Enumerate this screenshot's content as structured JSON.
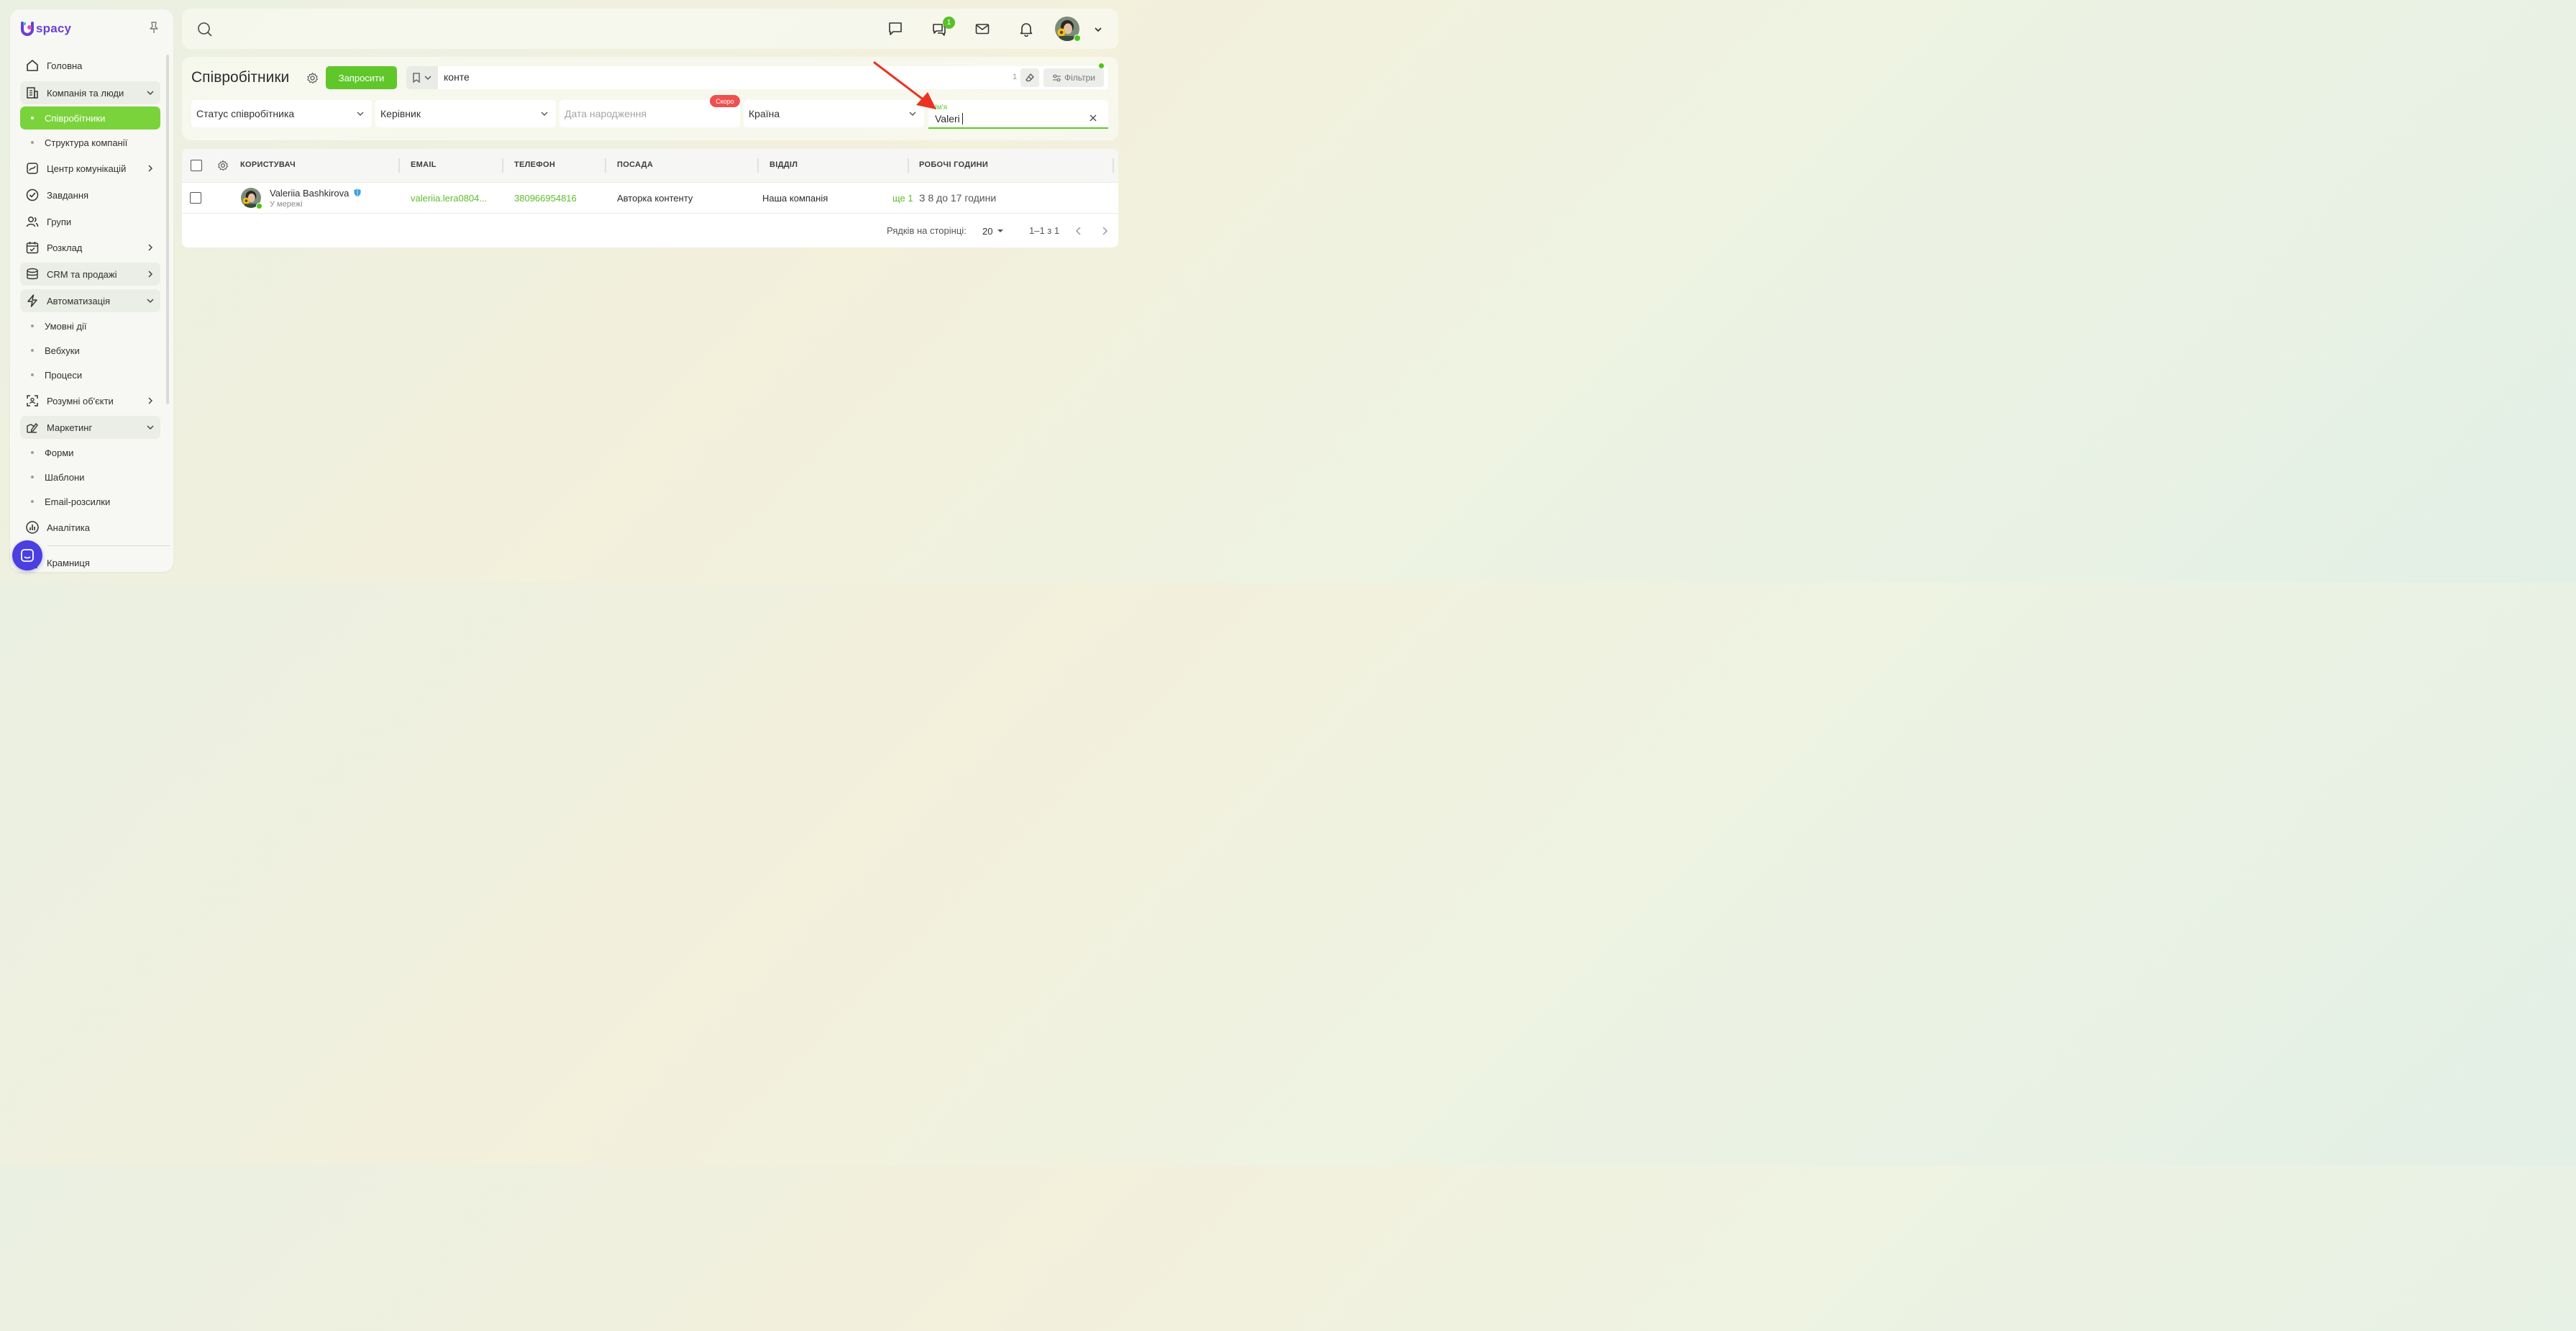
{
  "logo": {
    "text": "spacy",
    "brand_color": "#6a3fd6"
  },
  "sidebar": {
    "items": [
      {
        "label": "Головна",
        "icon": "home-icon"
      },
      {
        "label": "Компанія та люди",
        "icon": "company-icon"
      },
      {
        "label": "Співробітники",
        "icon": ""
      },
      {
        "label": "Структура компанії",
        "icon": ""
      },
      {
        "label": "Центр комунікацій",
        "icon": "communications-icon"
      },
      {
        "label": "Завдання",
        "icon": "tasks-icon"
      },
      {
        "label": "Групи",
        "icon": "groups-icon"
      },
      {
        "label": "Розклад",
        "icon": "calendar-icon"
      },
      {
        "label": "CRM та продажі",
        "icon": "crm-icon"
      },
      {
        "label": "Автоматизація",
        "icon": "automation-icon"
      },
      {
        "label": "Умовні дії",
        "icon": ""
      },
      {
        "label": "Вебхуки",
        "icon": ""
      },
      {
        "label": "Процеси",
        "icon": ""
      },
      {
        "label": "Розумні об'єкти",
        "icon": "smart-objects-icon"
      },
      {
        "label": "Маркетинг",
        "icon": "marketing-icon"
      },
      {
        "label": "Форми",
        "icon": ""
      },
      {
        "label": "Шаблони",
        "icon": ""
      },
      {
        "label": "Email-розсилки",
        "icon": ""
      },
      {
        "label": "Аналітика",
        "icon": "analytics-icon"
      },
      {
        "label": "Крамниця",
        "icon": "store-icon"
      }
    ],
    "active_color": "#7ad33a"
  },
  "topbar": {
    "chat_badge": "1"
  },
  "header": {
    "title": "Співробітники",
    "invite_label": "Запросити",
    "search_value": "конте",
    "search_count": "1",
    "filters_label": "Фільтри"
  },
  "filters": {
    "status": "Статус співробітника",
    "manager": "Керівник",
    "birthdate": "Дата народження",
    "soon_badge": "Скоро",
    "country": "Країна",
    "name_label": "Ім'я",
    "name_value": "Valeri"
  },
  "table": {
    "columns": [
      "КОРИСТУВАЧ",
      "EMAIL",
      "ТЕЛЕФОН",
      "ПОСАДА",
      "ВІДДІЛ",
      "РОБОЧІ ГОДИНИ"
    ],
    "rows": [
      {
        "name": "Valeriia Bashkirova",
        "status": "У мережі",
        "email": "valeriia.lera0804...",
        "phone": "380966954816",
        "position": "Авторка контенту",
        "department": "Наша компанія",
        "more": "ще 1",
        "hours": "З 8 до 17 години"
      }
    ]
  },
  "pagination": {
    "rows_per_page_label": "Рядків на сторінці:",
    "rows_per_page": "20",
    "range": "1–1 з 1"
  },
  "colors": {
    "accent": "#60c72b",
    "danger": "#ee5050",
    "fab": "#4a3fe0"
  }
}
